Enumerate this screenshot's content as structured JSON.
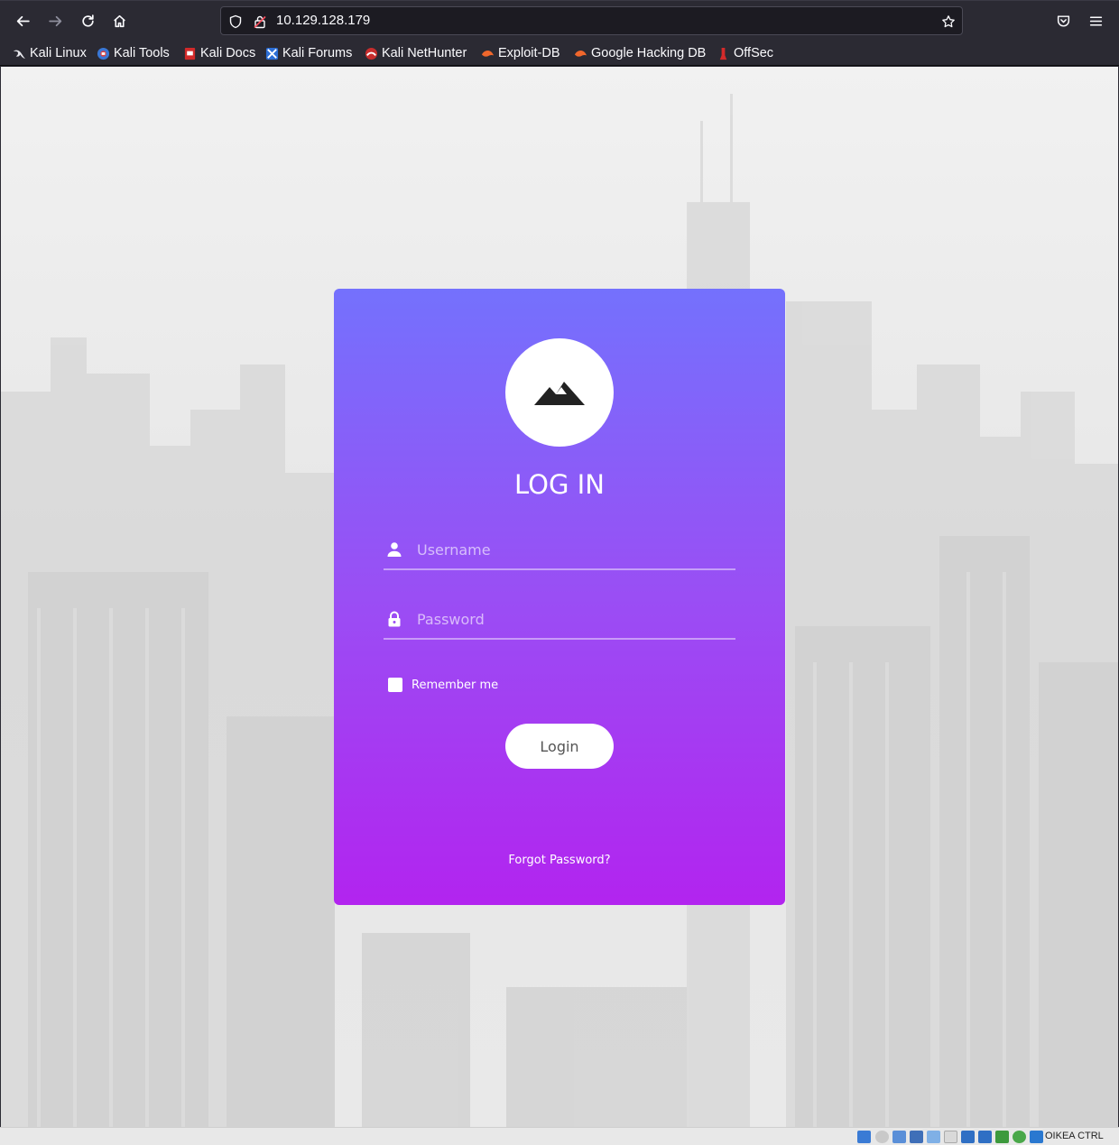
{
  "browser": {
    "url": "10.129.128.179",
    "bookmarks": [
      {
        "label": "Kali Linux",
        "icon": "kali-dragon-icon"
      },
      {
        "label": "Kali Tools",
        "icon": "kali-tools-icon"
      },
      {
        "label": "Kali Docs",
        "icon": "kali-docs-icon"
      },
      {
        "label": "Kali Forums",
        "icon": "kali-forums-icon"
      },
      {
        "label": "Kali NetHunter",
        "icon": "kali-nethunter-icon"
      },
      {
        "label": "Exploit-DB",
        "icon": "exploit-db-icon"
      },
      {
        "label": "Google Hacking DB",
        "icon": "ghdb-icon"
      },
      {
        "label": "OffSec",
        "icon": "offsec-icon"
      }
    ]
  },
  "login": {
    "title": "LOG IN",
    "username_placeholder": "Username",
    "password_placeholder": "Password",
    "remember_label": "Remember me",
    "button_label": "Login",
    "forgot_label": "Forgot Password?"
  },
  "status": {
    "host_key": "OIKEA CTRL"
  },
  "colors": {
    "card_top": "#7471fd",
    "card_bottom": "#b224ef",
    "chrome": "#2b2a33"
  }
}
